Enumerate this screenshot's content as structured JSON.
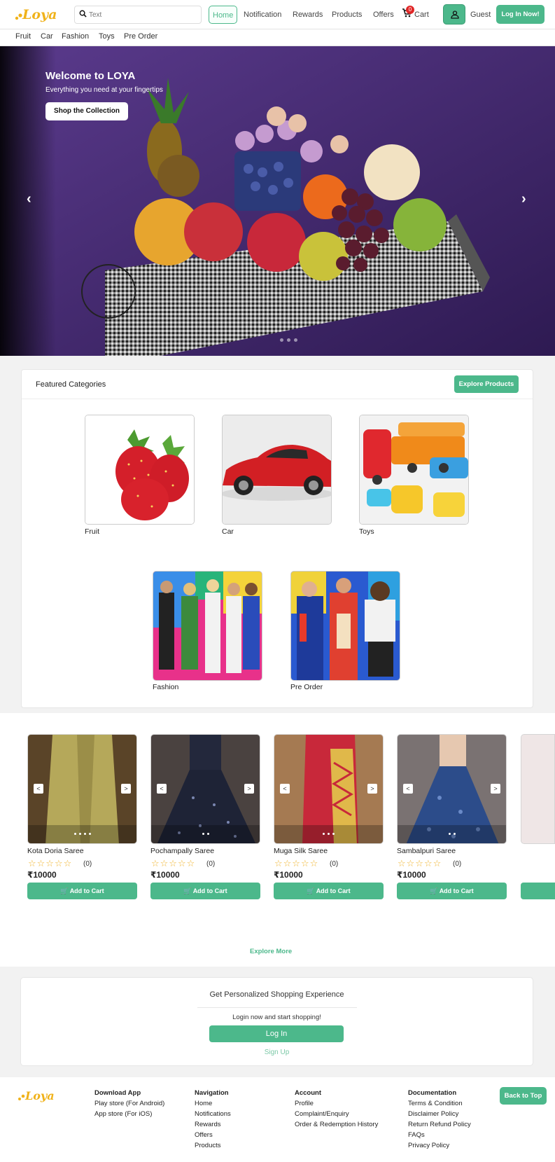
{
  "header": {
    "logo": "Loya",
    "search_placeholder": "Text",
    "nav": {
      "home": "Home",
      "notification": "Notification",
      "rewards": "Rewards",
      "products": "Products",
      "offers": "Offers",
      "cart": "Cart"
    },
    "cart_count": "0",
    "user_name": "Guest",
    "login_button": "Log In Now!"
  },
  "category_bar": [
    "Fruit",
    "Car",
    "Fashion",
    "Toys",
    "Pre Order"
  ],
  "hero": {
    "title": "Welcome to LOYA",
    "subtitle": "Everything you need at your fingertips",
    "button": "Shop the Collection",
    "prev_arrow": "‹",
    "next_arrow": "›"
  },
  "featured": {
    "title": "Featured Categories",
    "explore_button": "Explore Products",
    "categories": [
      "Fruit",
      "Car",
      "Toys",
      "Fashion",
      "Pre Order"
    ]
  },
  "products": [
    {
      "name": "Kota Doria Saree",
      "rating_count": "(0)",
      "price": "₹10000",
      "button": "Add to Cart"
    },
    {
      "name": "Pochampally Saree",
      "rating_count": "(0)",
      "price": "₹10000",
      "button": "Add to Cart"
    },
    {
      "name": "Muga Silk Saree",
      "rating_count": "(0)",
      "price": "₹10000",
      "button": "Add to Cart"
    },
    {
      "name": "Sambalpuri Saree",
      "rating_count": "(0)",
      "price": "₹10000",
      "button": "Add to Cart"
    }
  ],
  "explore_more": "Explore More",
  "personalized": {
    "title": "Get Personalized Shopping Experience",
    "subtitle": "Login now and start shopping!",
    "login_button": "Log In",
    "signup": "Sign Up"
  },
  "footer": {
    "logo": "Loya",
    "download": {
      "title": "Download App",
      "links": [
        "Play store (For Android)",
        "App store (For iOS)"
      ]
    },
    "navigation": {
      "title": "Navigation",
      "links": [
        "Home",
        "Notifications",
        "Rewards",
        "Offers",
        "Products"
      ]
    },
    "account": {
      "title": "Account",
      "links": [
        "Profile",
        "Complaint/Enquiry",
        "Order & Redemption History"
      ]
    },
    "documentation": {
      "title": "Documentation",
      "links": [
        "Terms & Condition",
        "Disclaimer Policy",
        "Return Refund Policy",
        "FAQs",
        "Privacy Policy"
      ]
    },
    "back_to_top": "Back to Top"
  },
  "colors": {
    "brand": "#4cb88b",
    "logo": "#f0b21a",
    "hero_bg": "#4a2c78"
  },
  "icons": [
    "search-icon",
    "cart-icon",
    "user-icon",
    "chevron-left-icon",
    "chevron-right-icon",
    "star-icon"
  ]
}
